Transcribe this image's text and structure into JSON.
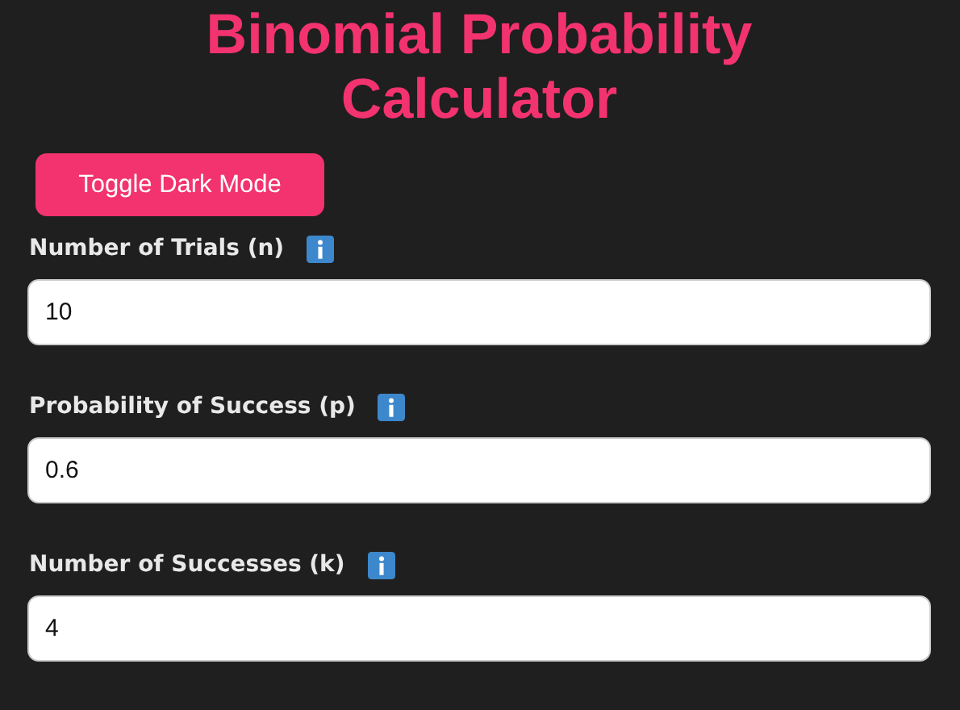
{
  "title": "Binomial Probability Calculator",
  "toggle_button": {
    "label": "Toggle Dark Mode"
  },
  "fields": [
    {
      "label": "Number of Trials (n)",
      "value": "10"
    },
    {
      "label": "Probability of Success (p)",
      "value": "0.6"
    },
    {
      "label": "Number of Successes (k)",
      "value": "4"
    }
  ]
}
